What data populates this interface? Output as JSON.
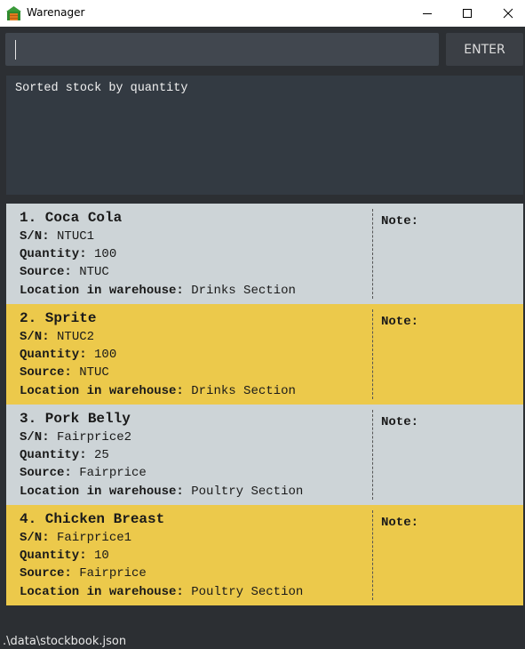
{
  "window": {
    "title": "Warenager",
    "icon": "warehouse-icon"
  },
  "command": {
    "input_value": "",
    "enter_label": "ENTER"
  },
  "result": {
    "text": "Sorted stock by quantity"
  },
  "labels": {
    "serial": "S/N:",
    "quantity": "Quantity:",
    "source": "Source:",
    "location": "Location in warehouse:",
    "note": "Note:"
  },
  "stocks": [
    {
      "title": "1. Coca Cola",
      "serial": "NTUC1",
      "quantity": "100",
      "source": "NTUC",
      "location": "Drinks Section",
      "note": ""
    },
    {
      "title": "2. Sprite",
      "serial": "NTUC2",
      "quantity": "100",
      "source": "NTUC",
      "location": "Drinks Section",
      "note": ""
    },
    {
      "title": "3. Pork Belly",
      "serial": "Fairprice2",
      "quantity": "25",
      "source": "Fairprice",
      "location": "Poultry Section",
      "note": ""
    },
    {
      "title": "4. Chicken Breast",
      "serial": "Fairprice1",
      "quantity": "10",
      "source": "Fairprice",
      "location": "Poultry Section",
      "note": ""
    }
  ],
  "status": {
    "path": ".\\data\\stockbook.json"
  },
  "colors": {
    "card_alt_1": "#cdd4d7",
    "card_alt_2": "#ecc94b",
    "background": "#2c2f33"
  }
}
